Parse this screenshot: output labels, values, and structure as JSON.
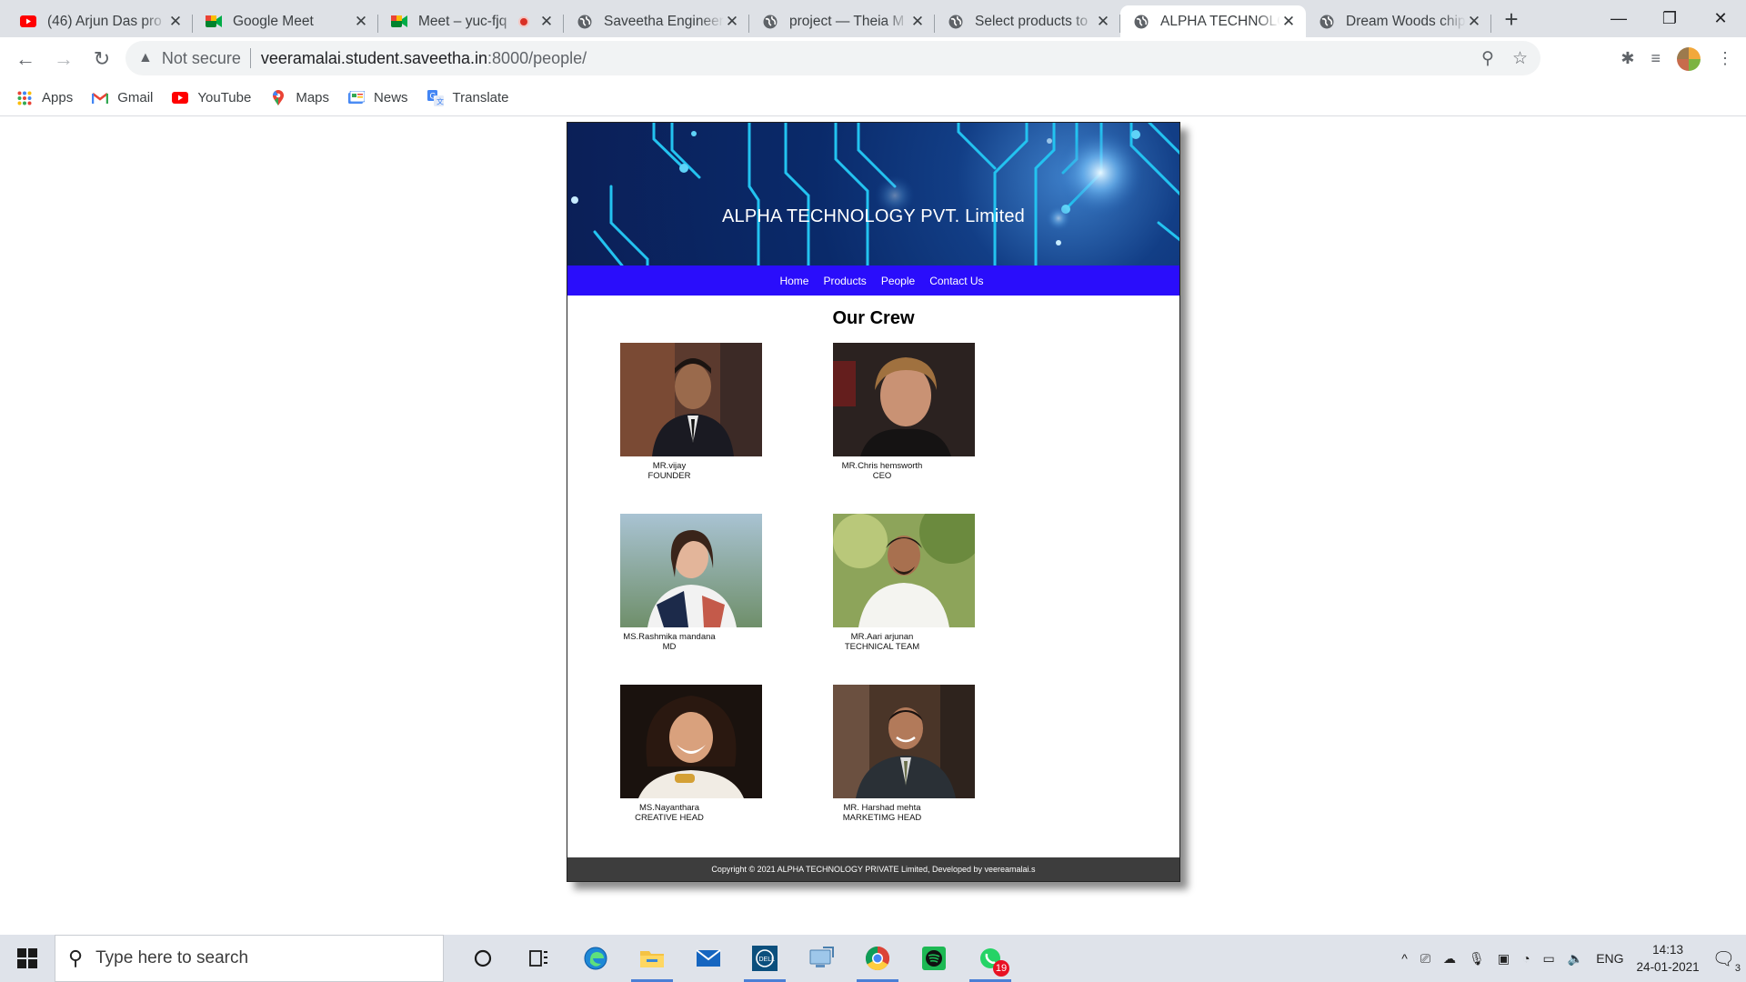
{
  "browser": {
    "tabs": [
      {
        "title": "(46) Arjun Das pro",
        "favicon": "youtube-icon",
        "recording": false,
        "active": false
      },
      {
        "title": "Google Meet",
        "favicon": "google-meet-icon",
        "recording": false,
        "active": false
      },
      {
        "title": "Meet – yuc-fjq",
        "favicon": "google-meet-icon",
        "recording": true,
        "active": false
      },
      {
        "title": "Saveetha Engineer",
        "favicon": "globe-icon",
        "recording": false,
        "active": false
      },
      {
        "title": "project — Theia M",
        "favicon": "globe-icon",
        "recording": false,
        "active": false
      },
      {
        "title": "Select products to",
        "favicon": "globe-icon",
        "recording": false,
        "active": false
      },
      {
        "title": "ALPHA TECHNOLO",
        "favicon": "globe-icon",
        "recording": false,
        "active": true
      },
      {
        "title": "Dream Woods chip",
        "favicon": "globe-icon",
        "recording": false,
        "active": false
      }
    ],
    "address": {
      "security_label": "Not secure",
      "host": "veeramalai.student.saveetha.in",
      "path": ":8000/people/"
    },
    "bookmarks": [
      {
        "label": "Apps",
        "icon": "apps-grid-icon"
      },
      {
        "label": "Gmail",
        "icon": "gmail-icon"
      },
      {
        "label": "YouTube",
        "icon": "youtube-icon"
      },
      {
        "label": "Maps",
        "icon": "maps-icon"
      },
      {
        "label": "News",
        "icon": "news-icon"
      },
      {
        "label": "Translate",
        "icon": "translate-icon"
      }
    ]
  },
  "site": {
    "banner_title": "ALPHA TECHNOLOGY PVT. Limited",
    "menu": [
      "Home",
      "Products",
      "People",
      "Contact Us"
    ],
    "section_title": "Our Crew",
    "members": [
      {
        "name": "MR.vijay",
        "role": "FOUNDER"
      },
      {
        "name": "MR.Chris hemsworth",
        "role": "CEO"
      },
      {
        "name": "MS.Rashmika mandana",
        "role": "MD"
      },
      {
        "name": "MR.Aari arjunan",
        "role": "TECHNICAL TEAM"
      },
      {
        "name": "MS.Nayanthara",
        "role": "CREATIVE HEAD"
      },
      {
        "name": "MR. Harshad mehta",
        "role": "MARKETIMG HEAD"
      }
    ],
    "footer": "Copyright © 2021 ALPHA TECHNOLOGY PRIVATE Limited, Developed by veereamalai.s",
    "colors": {
      "menu_bar": "#2a0dfb",
      "footer": "#3d3d3d",
      "banner": "#0b2a6e"
    }
  },
  "taskbar": {
    "search_placeholder": "Type here to search",
    "language": "ENG",
    "time": "14:13",
    "date": "24-01-2021",
    "whatsapp_badge": "19",
    "notifications_count": "3"
  }
}
